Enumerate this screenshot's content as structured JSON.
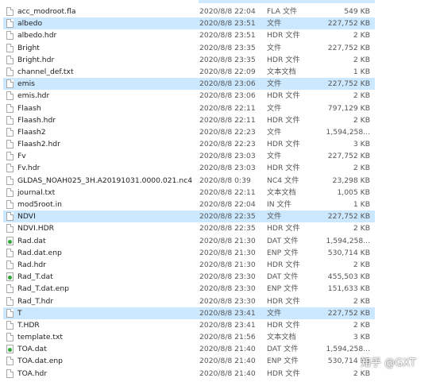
{
  "files": [
    {
      "name": "acc_modroot.fla",
      "date": "2020/8/8 22:04",
      "type": "FLA 文件",
      "size": "549 KB",
      "icon": "document-icon",
      "selected": false
    },
    {
      "name": "albedo",
      "date": "2020/8/8 23:51",
      "type": "文件",
      "size": "227,752 KB",
      "icon": "document-icon",
      "selected": true
    },
    {
      "name": "albedo.hdr",
      "date": "2020/8/8 23:51",
      "type": "HDR 文件",
      "size": "2 KB",
      "icon": "document-icon",
      "selected": false
    },
    {
      "name": "Bright",
      "date": "2020/8/8 23:35",
      "type": "文件",
      "size": "227,752 KB",
      "icon": "document-icon",
      "selected": false
    },
    {
      "name": "Bright.hdr",
      "date": "2020/8/8 23:35",
      "type": "HDR 文件",
      "size": "2 KB",
      "icon": "document-icon",
      "selected": false
    },
    {
      "name": "channel_def.txt",
      "date": "2020/8/8 22:09",
      "type": "文本文档",
      "size": "1 KB",
      "icon": "document-icon",
      "selected": false
    },
    {
      "name": "emis",
      "date": "2020/8/8 23:06",
      "type": "文件",
      "size": "227,752 KB",
      "icon": "document-icon",
      "selected": true
    },
    {
      "name": "emis.hdr",
      "date": "2020/8/8 23:06",
      "type": "HDR 文件",
      "size": "2 KB",
      "icon": "document-icon",
      "selected": false
    },
    {
      "name": "Flaash",
      "date": "2020/8/8 22:11",
      "type": "文件",
      "size": "797,129 KB",
      "icon": "document-icon",
      "selected": false
    },
    {
      "name": "Flaash.hdr",
      "date": "2020/8/8 22:11",
      "type": "HDR 文件",
      "size": "2 KB",
      "icon": "document-icon",
      "selected": false
    },
    {
      "name": "Flaash2",
      "date": "2020/8/8 22:23",
      "type": "文件",
      "size": "1,594,258...",
      "icon": "document-icon",
      "selected": false
    },
    {
      "name": "Flaash2.hdr",
      "date": "2020/8/8 22:23",
      "type": "HDR 文件",
      "size": "3 KB",
      "icon": "document-icon",
      "selected": false
    },
    {
      "name": "Fv",
      "date": "2020/8/8 23:03",
      "type": "文件",
      "size": "227,752 KB",
      "icon": "document-icon",
      "selected": false
    },
    {
      "name": "Fv.hdr",
      "date": "2020/8/8 23:03",
      "type": "HDR 文件",
      "size": "2 KB",
      "icon": "document-icon",
      "selected": false
    },
    {
      "name": "GLDAS_NOAH025_3H.A20191031.0000.021.nc4",
      "date": "2020/8/8 0:39",
      "type": "NC4 文件",
      "size": "23,298 KB",
      "icon": "document-icon",
      "selected": false
    },
    {
      "name": "journal.txt",
      "date": "2020/8/8 22:11",
      "type": "文本文档",
      "size": "1,005 KB",
      "icon": "document-icon",
      "selected": false
    },
    {
      "name": "mod5root.in",
      "date": "2020/8/8 22:04",
      "type": "IN 文件",
      "size": "1 KB",
      "icon": "document-icon",
      "selected": false
    },
    {
      "name": "NDVI",
      "date": "2020/8/8 22:35",
      "type": "文件",
      "size": "227,752 KB",
      "icon": "document-icon",
      "selected": true
    },
    {
      "name": "NDVI.HDR",
      "date": "2020/8/8 22:35",
      "type": "HDR 文件",
      "size": "2 KB",
      "icon": "document-icon",
      "selected": false
    },
    {
      "name": "Rad.dat",
      "date": "2020/8/8 21:30",
      "type": "DAT 文件",
      "size": "1,594,258...",
      "icon": "dat-file-icon",
      "selected": false
    },
    {
      "name": "Rad.dat.enp",
      "date": "2020/8/8 21:30",
      "type": "ENP 文件",
      "size": "530,714 KB",
      "icon": "document-icon",
      "selected": false
    },
    {
      "name": "Rad.hdr",
      "date": "2020/8/8 21:30",
      "type": "HDR 文件",
      "size": "2 KB",
      "icon": "document-icon",
      "selected": false
    },
    {
      "name": "Rad_T.dat",
      "date": "2020/8/8 23:30",
      "type": "DAT 文件",
      "size": "455,503 KB",
      "icon": "dat-file-icon",
      "selected": false
    },
    {
      "name": "Rad_T.dat.enp",
      "date": "2020/8/8 23:30",
      "type": "ENP 文件",
      "size": "151,633 KB",
      "icon": "document-icon",
      "selected": false
    },
    {
      "name": "Rad_T.hdr",
      "date": "2020/8/8 23:30",
      "type": "HDR 文件",
      "size": "2 KB",
      "icon": "document-icon",
      "selected": false
    },
    {
      "name": "T",
      "date": "2020/8/8 23:41",
      "type": "文件",
      "size": "227,752 KB",
      "icon": "document-icon",
      "selected": true
    },
    {
      "name": "T.HDR",
      "date": "2020/8/8 23:41",
      "type": "HDR 文件",
      "size": "2 KB",
      "icon": "document-icon",
      "selected": false
    },
    {
      "name": "template.txt",
      "date": "2020/8/8 21:56",
      "type": "文本文档",
      "size": "3 KB",
      "icon": "document-icon",
      "selected": false
    },
    {
      "name": "TOA.dat",
      "date": "2020/8/8 21:40",
      "type": "DAT 文件",
      "size": "1,594,258...",
      "icon": "dat-file-icon",
      "selected": false
    },
    {
      "name": "TOA.dat.enp",
      "date": "2020/8/8 21:40",
      "type": "ENP 文件",
      "size": "530,714 KB",
      "icon": "document-icon",
      "selected": false
    },
    {
      "name": "TOA.hdr",
      "date": "2020/8/8 21:40",
      "type": "HDR 文件",
      "size": "2 KB",
      "icon": "document-icon",
      "selected": false
    }
  ],
  "watermark": "知乎 @GXT",
  "colors": {
    "selection": "#cce8ff",
    "dat_icon_dot": "#33a83a"
  }
}
